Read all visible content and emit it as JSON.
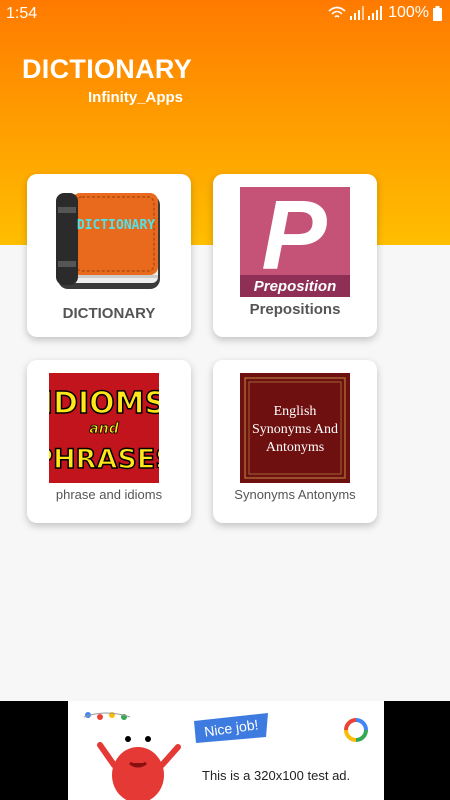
{
  "status": {
    "time": "1:54",
    "battery": "100%"
  },
  "header": {
    "title": "DICTIONARY",
    "subtitle": "Infinity_Apps"
  },
  "cards": [
    {
      "label": "DICTIONARY",
      "icon": "dictionary-book-icon",
      "icon_text": "DICTIONARY"
    },
    {
      "label": "Prepositions",
      "icon": "preposition-icon",
      "icon_letter": "P",
      "icon_text": "Preposition"
    },
    {
      "label": "phrase and idioms",
      "icon": "idioms-phrases-icon",
      "icon_line1": "IDIOMS",
      "icon_line2": "and",
      "icon_line3": "PHRASES"
    },
    {
      "label": "Synonyms Antonyms",
      "icon": "synonyms-antonyms-book-icon",
      "icon_line1": "English",
      "icon_line2": "Synonyms And",
      "icon_line3": "Antonyms"
    }
  ],
  "ad": {
    "bubble": "Nice job!",
    "text": "This is a 320x100 test ad."
  },
  "colors": {
    "header_top": "#ff7a00",
    "header_bottom": "#ffbe00",
    "background": "#f7f7f7"
  }
}
